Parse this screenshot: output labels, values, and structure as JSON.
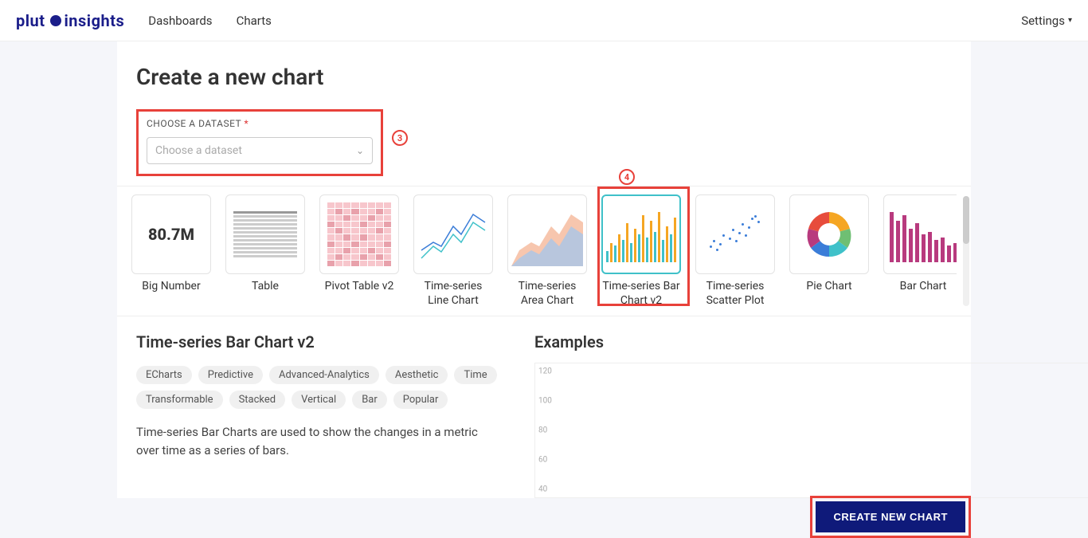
{
  "brand": {
    "name": "pluto insights"
  },
  "nav": {
    "dashboards": "Dashboards",
    "charts": "Charts",
    "settings": "Settings"
  },
  "page": {
    "title": "Create a new chart"
  },
  "dataset": {
    "label": "CHOOSE A DATASET",
    "required": "*",
    "placeholder": "Choose a dataset"
  },
  "markers": {
    "m3": "3",
    "m4": "4"
  },
  "chart_types": [
    {
      "id": "bignumber",
      "label": "Big Number",
      "value": "80.7M"
    },
    {
      "id": "table",
      "label": "Table"
    },
    {
      "id": "pivot",
      "label": "Pivot Table v2"
    },
    {
      "id": "line",
      "label": "Time-series Line Chart"
    },
    {
      "id": "area",
      "label": "Time-series Area Chart"
    },
    {
      "id": "bar_ts",
      "label": "Time-series Bar Chart v2",
      "selected": true
    },
    {
      "id": "scatter",
      "label": "Time-series Scatter Plot"
    },
    {
      "id": "pie",
      "label": "Pie Chart"
    },
    {
      "id": "bar",
      "label": "Bar Chart"
    }
  ],
  "detail": {
    "title": "Time-series Bar Chart v2",
    "tags": [
      "ECharts",
      "Predictive",
      "Advanced-Analytics",
      "Aesthetic",
      "Time",
      "Transformable",
      "Stacked",
      "Vertical",
      "Bar",
      "Popular"
    ],
    "description": "Time-series Bar Charts are used to show the changes in a metric over time as a series of bars."
  },
  "examples": {
    "title": "Examples",
    "yticks": [
      "120",
      "100",
      "80",
      "60",
      "40"
    ]
  },
  "create_button": "CREATE NEW CHART",
  "colors": {
    "accent": "#1b1e8a",
    "highlight_border": "#e8413a",
    "teal": "#3fc1c9",
    "orange": "#f5a623",
    "green": "#6fbf73",
    "blue": "#3b7dd8",
    "pink": "#e07ca3"
  }
}
